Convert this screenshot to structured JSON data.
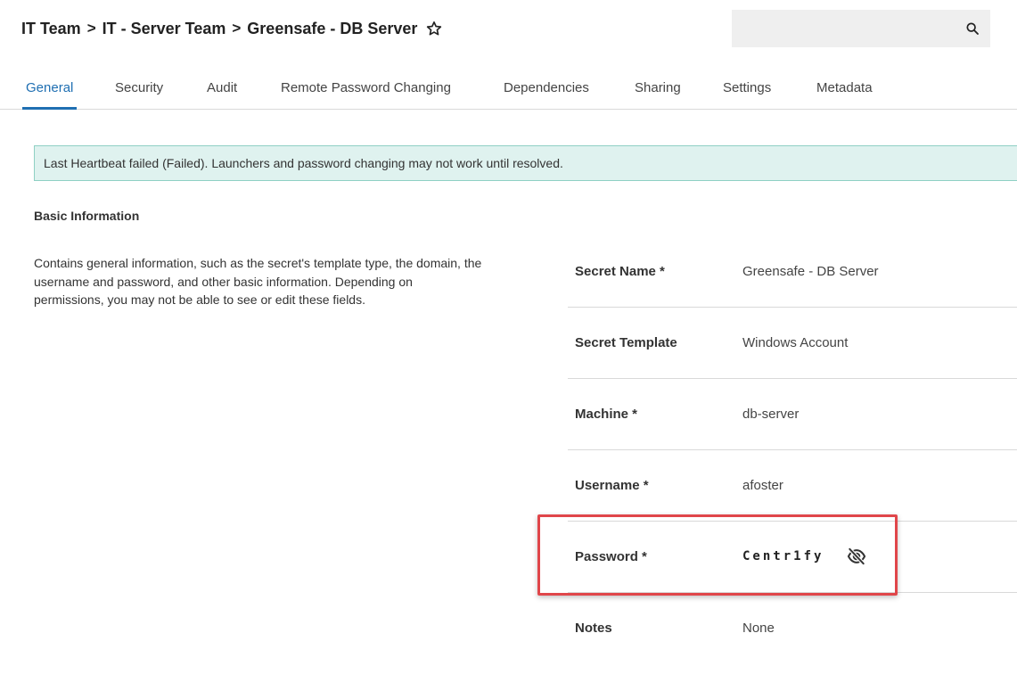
{
  "header": {
    "breadcrumb": [
      "IT Team",
      "IT - Server Team",
      "Greensafe - DB Server"
    ],
    "separator": ">",
    "search": {
      "value": "",
      "placeholder": ""
    }
  },
  "tabs": [
    {
      "label": "General",
      "active": true
    },
    {
      "label": "Security",
      "active": false
    },
    {
      "label": "Audit",
      "active": false
    },
    {
      "label": "Remote Password Changing",
      "active": false
    },
    {
      "label": "Dependencies",
      "active": false
    },
    {
      "label": "Sharing",
      "active": false
    },
    {
      "label": "Settings",
      "active": false
    },
    {
      "label": "Metadata",
      "active": false
    }
  ],
  "alert": {
    "text": "Last Heartbeat failed (Failed). Launchers and password changing may not work until resolved."
  },
  "basic_info": {
    "title": "Basic Information",
    "description": "Contains general information, such as the secret's template type, the domain, the username and password, and other basic information. Depending on permissions, you may not be able to see or edit these fields."
  },
  "fields": [
    {
      "label": "Secret Name *",
      "value": "Greensafe - DB Server"
    },
    {
      "label": "Secret Template",
      "value": "Windows Account"
    },
    {
      "label": "Machine *",
      "value": "db-server"
    },
    {
      "label": "Username *",
      "value": "afoster"
    },
    {
      "label": "Password *",
      "value": "Centr1fy"
    },
    {
      "label": "Notes",
      "value": "None"
    }
  ],
  "icons": {
    "favorite": "star-outline-icon",
    "search": "search-icon",
    "password_visibility": "eye-off-icon"
  },
  "colors": {
    "accent": "#1f6fb2",
    "alert_bg": "#dff2ef",
    "alert_border": "#8fd0c4",
    "highlight": "#e0464a"
  }
}
